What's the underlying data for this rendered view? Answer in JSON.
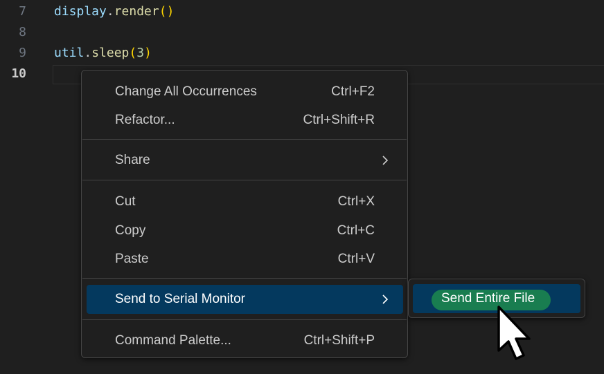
{
  "editor": {
    "lines": [
      {
        "number": "7",
        "tokens": [
          {
            "t": "display",
            "c": "tok-id"
          },
          {
            "t": ".",
            "c": "tok-punc"
          },
          {
            "t": "render",
            "c": "tok-fn"
          },
          {
            "t": "()",
            "c": "tok-paren"
          }
        ]
      },
      {
        "number": "8",
        "tokens": []
      },
      {
        "number": "9",
        "tokens": [
          {
            "t": "util",
            "c": "tok-id"
          },
          {
            "t": ".",
            "c": "tok-punc"
          },
          {
            "t": "sleep",
            "c": "tok-fn"
          },
          {
            "t": "(",
            "c": "tok-paren"
          },
          {
            "t": "3",
            "c": "tok-num"
          },
          {
            "t": ")",
            "c": "tok-paren"
          }
        ]
      },
      {
        "number": "10",
        "tokens": []
      }
    ]
  },
  "context_menu": {
    "items": [
      {
        "label": "Change All Occurrences",
        "shortcut": "Ctrl+F2"
      },
      {
        "label": "Refactor...",
        "shortcut": "Ctrl+Shift+R"
      },
      {
        "label": "Share",
        "shortcut": ""
      },
      {
        "label": "Cut",
        "shortcut": "Ctrl+X"
      },
      {
        "label": "Copy",
        "shortcut": "Ctrl+C"
      },
      {
        "label": "Paste",
        "shortcut": "Ctrl+V"
      },
      {
        "label": "Send to Serial Monitor",
        "shortcut": ""
      },
      {
        "label": "Command Palette...",
        "shortcut": "Ctrl+Shift+P"
      }
    ],
    "submenu": {
      "label": "Send Entire File"
    }
  },
  "icons": {
    "submenu_chevron": "chevron-right-icon",
    "pointer": "mouse-pointer-icon"
  },
  "colors": {
    "background": "#1f1f1f",
    "selection": "#04395e",
    "highlight": "#1d8a4e"
  }
}
